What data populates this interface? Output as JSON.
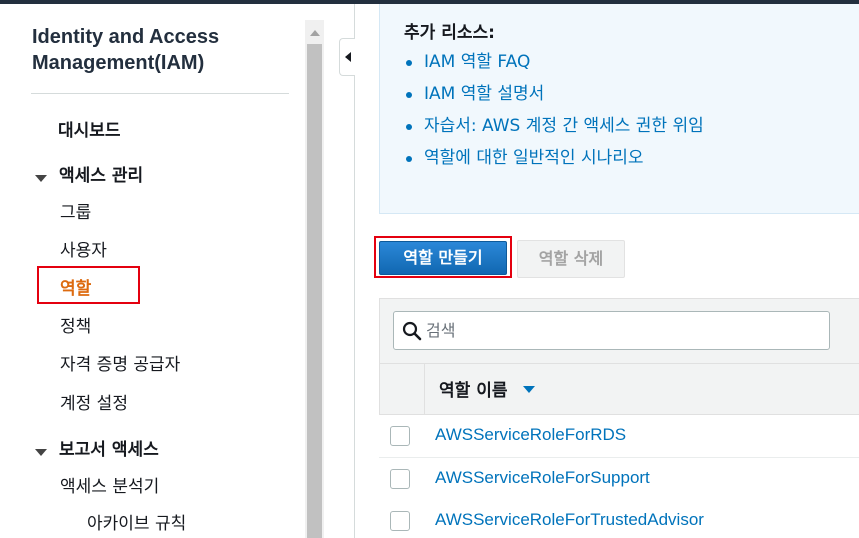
{
  "sidebar": {
    "title": "Identity and Access Management(IAM)",
    "dashboard": "대시보드",
    "access_mgmt": {
      "label": "액세스 관리",
      "items": [
        "그룹",
        "사용자",
        "역할",
        "정책",
        "자격 증명 공급자",
        "계정 설정"
      ]
    },
    "active_item": "역할",
    "report_access": {
      "label": "보고서 액세스",
      "items": [
        "액세스 분석기",
        "아카이브 규칙"
      ]
    }
  },
  "info": {
    "heading": "추가 리소스:",
    "links": [
      "IAM 역할 FAQ",
      "IAM 역할 설명서",
      "자습서: AWS 계정 간 액세스 권한 위임",
      "역할에 대한 일반적인 시나리오"
    ]
  },
  "actions": {
    "create_role": "역할 만들기",
    "delete_role": "역할 삭제"
  },
  "search": {
    "placeholder": "검색"
  },
  "table": {
    "column_role_name": "역할 이름",
    "rows": [
      "AWSServiceRoleForRDS",
      "AWSServiceRoleForSupport",
      "AWSServiceRoleForTrustedAdvisor"
    ]
  },
  "colors": {
    "accent_blue": "#0073bb",
    "active_orange": "#dd6b10",
    "highlight_red": "#e4000f"
  }
}
